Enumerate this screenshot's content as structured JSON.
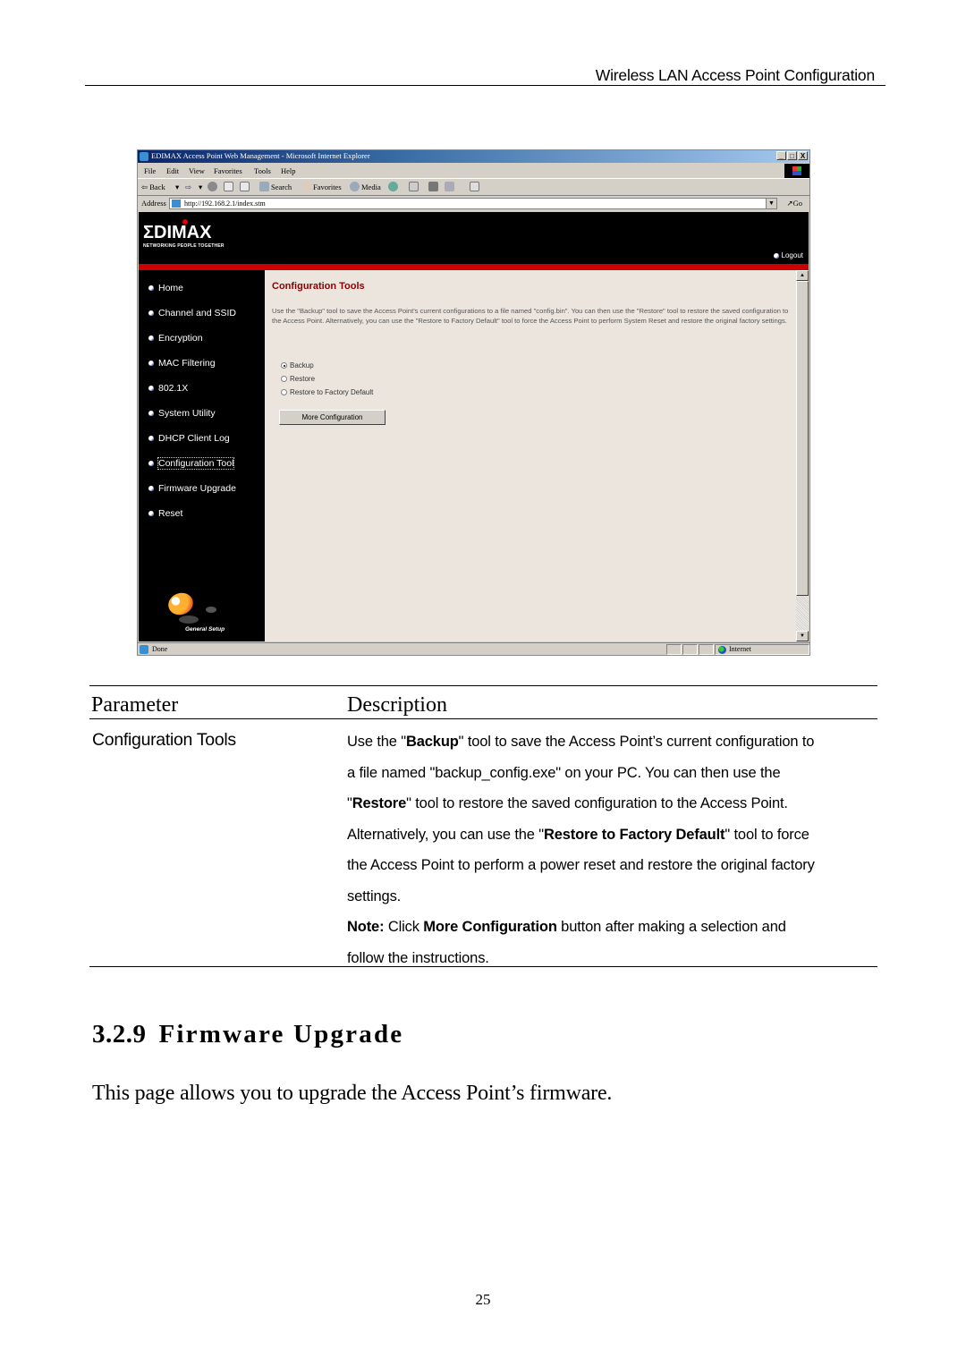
{
  "running_header": "Wireless LAN Access Point Configuration",
  "browser": {
    "title": "EDIMAX Access Point Web Management - Microsoft Internet Explorer",
    "window_buttons": [
      "_",
      "□",
      "X"
    ],
    "menu": [
      "File",
      "Edit",
      "View",
      "Favorites",
      "Tools",
      "Help"
    ],
    "toolbar": {
      "back": "⇦ Back",
      "search": "Search",
      "favorites": "Favorites",
      "media": "Media"
    },
    "address_label": "Address",
    "address_url": "http://192.168.2.1/index.stm",
    "go_label": "Go",
    "status_text": "Done",
    "zone_text": "Internet"
  },
  "app": {
    "logo": "ΣDIMAX",
    "tagline": "NETWORKING PEOPLE TOGETHER",
    "logout_label": "Logout",
    "nav": [
      {
        "label": "Home",
        "active": false
      },
      {
        "label": "Channel and SSID",
        "active": false
      },
      {
        "label": "Encryption",
        "active": false
      },
      {
        "label": "MAC Filtering",
        "active": false
      },
      {
        "label": "802.1X",
        "active": false
      },
      {
        "label": "System Utility",
        "active": false
      },
      {
        "label": "DHCP Client Log",
        "active": false
      },
      {
        "label": "Configuration Tool",
        "active": true
      },
      {
        "label": "Firmware Upgrade",
        "active": false
      },
      {
        "label": "Reset",
        "active": false
      }
    ],
    "general_setup_label": "General Setup",
    "page_title": "Configuration Tools",
    "page_description": "Use the \"Backup\" tool to save the Access Point's current configurations to a file named \"config.bin\". You can then use the \"Restore\" tool to restore the saved configuration to the Access Point. Alternatively, you can use the \"Restore to Factory Default\" tool to force the Access Point to perform System Reset and restore the original factory settings.",
    "options": [
      {
        "label": "Backup",
        "selected": true
      },
      {
        "label": "Restore",
        "selected": false
      },
      {
        "label": "Restore to Factory Default",
        "selected": false
      }
    ],
    "more_button": "More Configuration"
  },
  "param_table": {
    "header_param": "Parameter",
    "header_desc": "Description",
    "rows": [
      {
        "name": "Configuration Tools",
        "lines": [
          [
            {
              "t": "Use the \""
            },
            {
              "t": "Backup",
              "b": true
            },
            {
              "t": "\" tool to save the Access Point’s current configuration to"
            }
          ],
          [
            {
              "t": "a file named \"backup_config.exe\" on your PC. You can then use the"
            }
          ],
          [
            {
              "t": "\""
            },
            {
              "t": "Restore",
              "b": true
            },
            {
              "t": "\" tool to restore the saved configuration to the Access Point."
            }
          ],
          [
            {
              "t": "Alternatively, you can use the \""
            },
            {
              "t": "Restore to Factory Default",
              "b": true
            },
            {
              "t": "\" tool to force"
            }
          ],
          [
            {
              "t": "the Access Point to perform a power reset and restore the original factory"
            }
          ],
          [
            {
              "t": "settings."
            }
          ],
          [
            {
              "t": "Note:",
              "b": true
            },
            {
              "t": " Click "
            },
            {
              "t": "More Configuration",
              "b": true
            },
            {
              "t": " button after making a selection and"
            }
          ],
          [
            {
              "t": "follow the instructions."
            }
          ]
        ]
      }
    ]
  },
  "section": {
    "number": "3.2.9",
    "title": "Firmware Upgrade",
    "body": "This page allows you to upgrade the Access Point’s firmware."
  },
  "page_number": "25"
}
